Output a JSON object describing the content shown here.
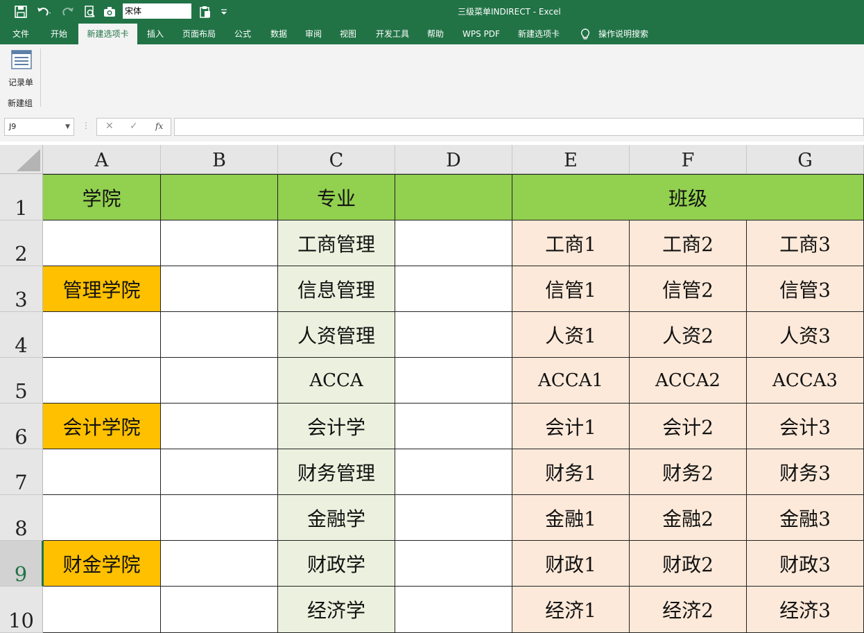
{
  "titlebar": {
    "font_name": "宋体",
    "title": "三级菜单INDIRECT  -  Excel"
  },
  "tabs": [
    "文件",
    "开始",
    "新建选项卡",
    "插入",
    "页面布局",
    "公式",
    "数据",
    "审阅",
    "视图",
    "开发工具",
    "帮助",
    "WPS PDF",
    "新建选项卡",
    "操作说明搜索"
  ],
  "ribbon": {
    "record_label": "记录单",
    "group_label": "新建组"
  },
  "formula_bar": {
    "name_box": "J9",
    "cancel": "✕",
    "enter": "✓",
    "fx": "fx",
    "value": ""
  },
  "columns": [
    "A",
    "B",
    "C",
    "D",
    "E",
    "F",
    "G"
  ],
  "rows": [
    "1",
    "2",
    "3",
    "4",
    "5",
    "6",
    "7",
    "8",
    "9",
    "10"
  ],
  "header_row": {
    "a": "学院",
    "c": "专业",
    "efg": "班级"
  },
  "colleges": {
    "r3": "管理学院",
    "r6": "会计学院",
    "r9": "财金学院"
  },
  "majors": [
    "工商管理",
    "信息管理",
    "人资管理",
    "ACCA",
    "会计学",
    "财务管理",
    "金融学",
    "财政学",
    "经济学"
  ],
  "classes": [
    [
      "工商1",
      "工商2",
      "工商3"
    ],
    [
      "信管1",
      "信管2",
      "信管3"
    ],
    [
      "人资1",
      "人资2",
      "人资3"
    ],
    [
      "ACCA1",
      "ACCA2",
      "ACCA3"
    ],
    [
      "会计1",
      "会计2",
      "会计3"
    ],
    [
      "财务1",
      "财务2",
      "财务3"
    ],
    [
      "金融1",
      "金融2",
      "金融3"
    ],
    [
      "财政1",
      "财政2",
      "财政3"
    ],
    [
      "经济1",
      "经济2",
      "经济3"
    ]
  ],
  "colors": {
    "excel_green": "#217346",
    "header_green": "#92d050",
    "college_orange": "#ffc000",
    "major_fill": "#ebf1de",
    "class_fill": "#fde9d9"
  }
}
